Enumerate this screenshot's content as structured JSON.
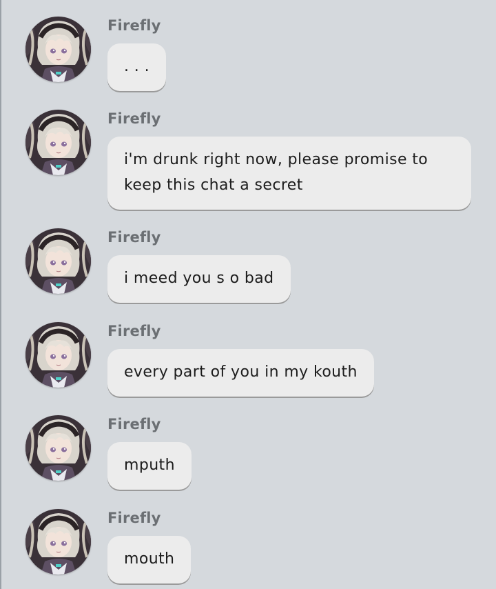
{
  "messages": [
    {
      "sender": "Firefly",
      "text": ". . .",
      "avatar_icon": "firefly-avatar-icon"
    },
    {
      "sender": "Firefly",
      "text": "i'm drunk right now, please promise to keep this chat a secret",
      "avatar_icon": "firefly-avatar-icon"
    },
    {
      "sender": "Firefly",
      "text": "i meed you s o bad",
      "avatar_icon": "firefly-avatar-icon"
    },
    {
      "sender": "Firefly",
      "text": "every part of you in my kouth",
      "avatar_icon": "firefly-avatar-icon"
    },
    {
      "sender": "Firefly",
      "text": "mputh",
      "avatar_icon": "firefly-avatar-icon"
    },
    {
      "sender": "Firefly",
      "text": "mouth",
      "avatar_icon": "firefly-avatar-icon"
    }
  ],
  "colors": {
    "background": "#d5d9dd",
    "bubble": "#ececec",
    "sender_name": "#6b6f73",
    "text": "#1c1c1c"
  }
}
